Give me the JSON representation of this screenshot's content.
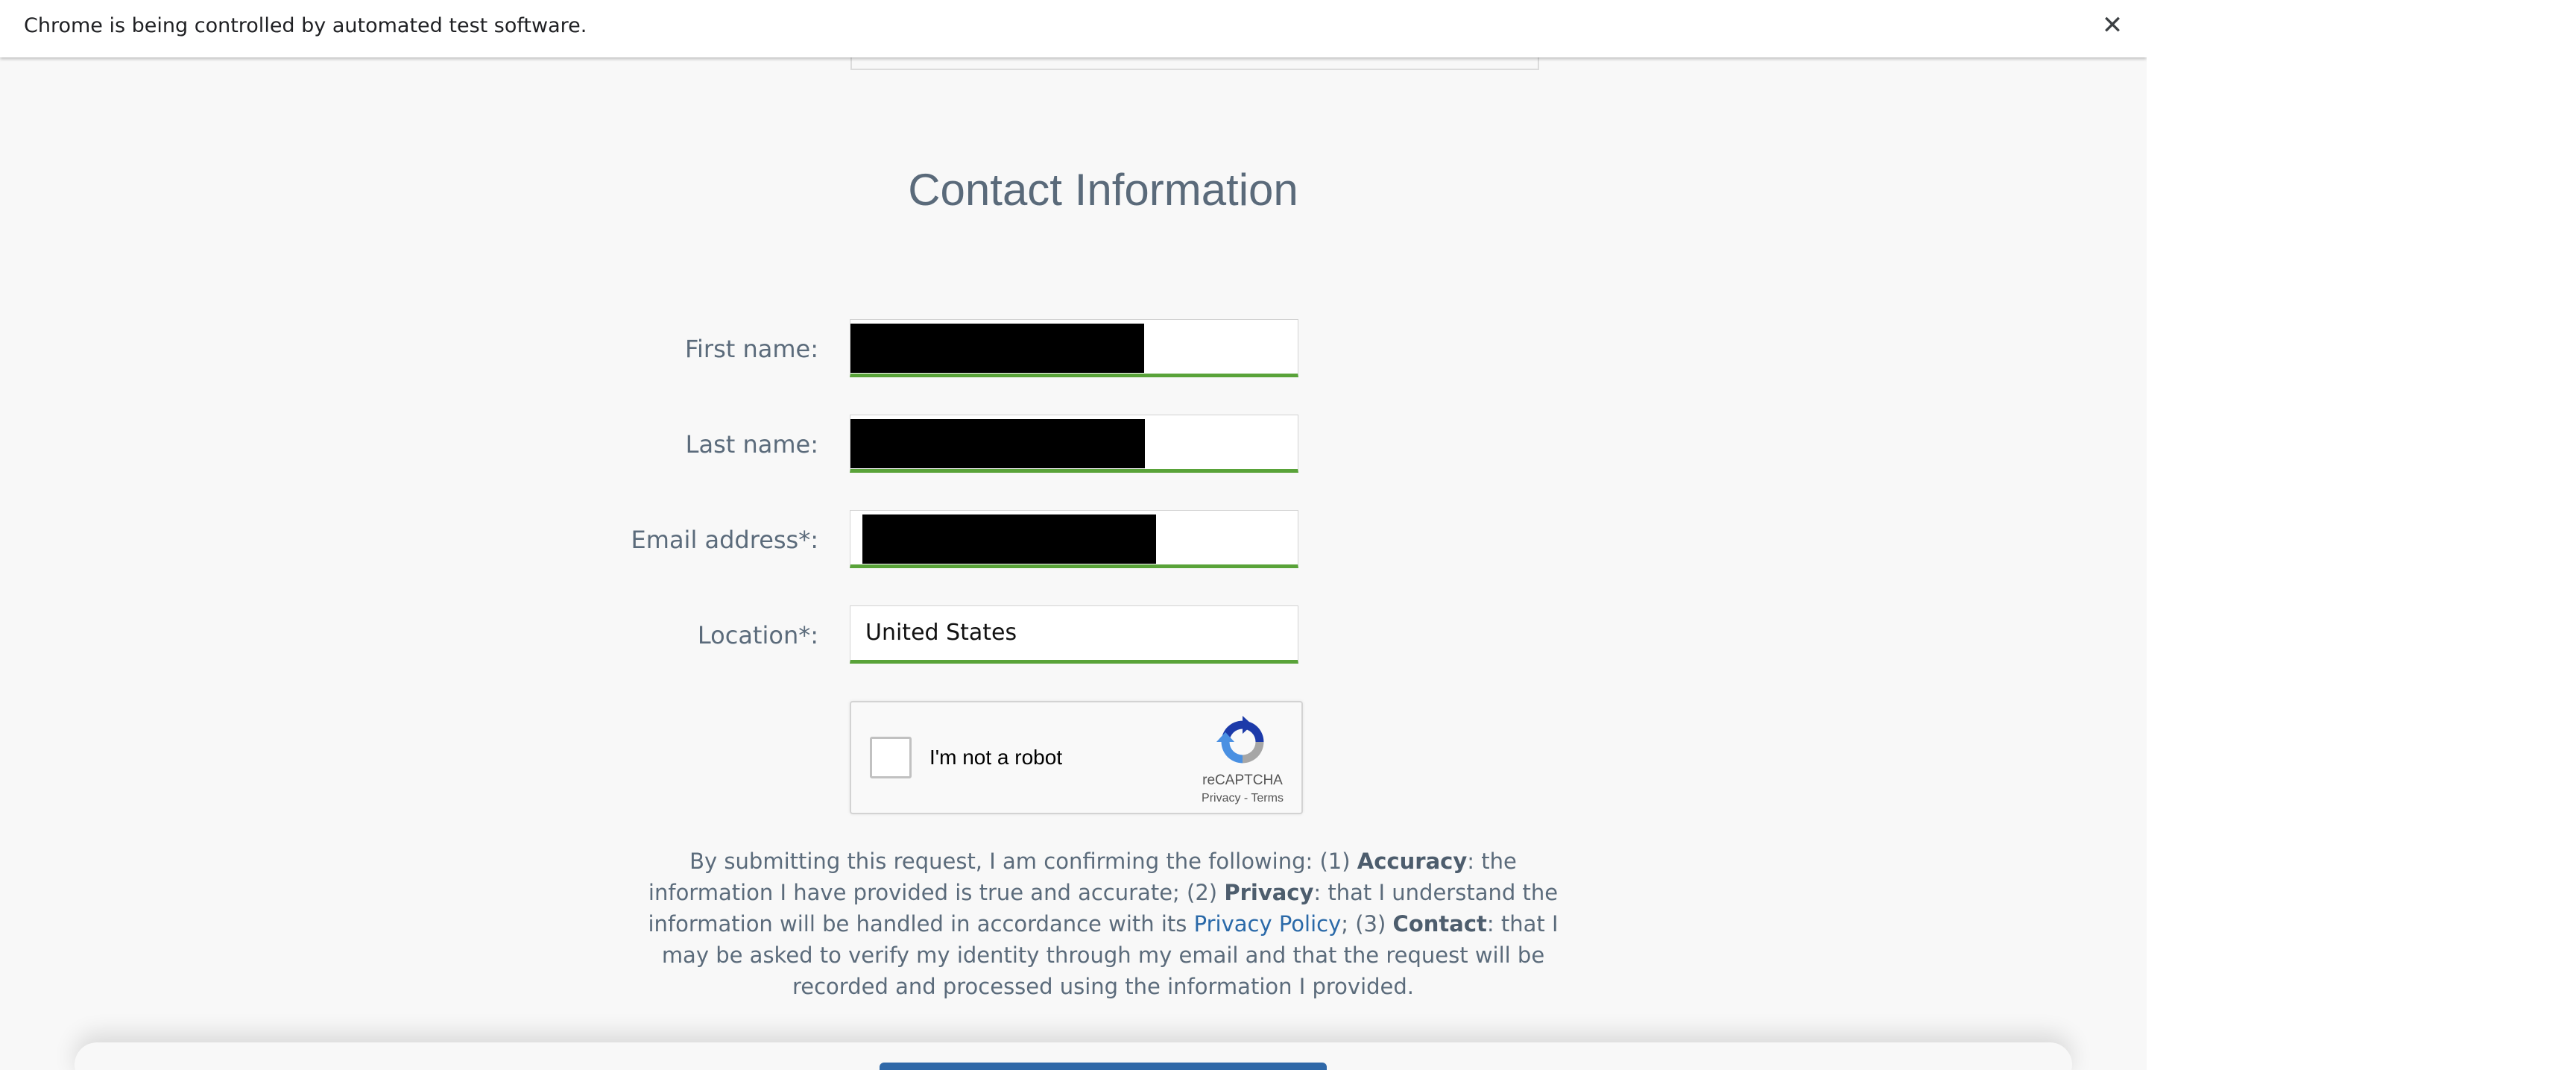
{
  "infobar": {
    "message": "Chrome is being controlled by automated test software.",
    "close_glyph": "✕",
    "close_icon": "close-icon"
  },
  "section": {
    "title": "Contact Information"
  },
  "form": {
    "first_name": {
      "label": "First name:",
      "value": ""
    },
    "last_name": {
      "label": "Last name:",
      "value": ""
    },
    "email": {
      "label": "Email address*:",
      "value": ""
    },
    "location": {
      "label": "Location*:",
      "value": "United States"
    }
  },
  "captcha": {
    "label": "I'm not a robot",
    "brand": "reCAPTCHA",
    "privacy": "Privacy",
    "separator": " - ",
    "terms": "Terms",
    "logo_icon": "recaptcha-logo-icon"
  },
  "disclaimer": {
    "p1": "By submitting this request, I am confirming the following: (1) ",
    "accuracy": "Accuracy",
    "p2": ": the information I have provided is true and accurate; (2) ",
    "privacy": "Privacy",
    "p3": ": that I understand the information will be handled in accordance with its ",
    "privacy_policy": "Privacy Policy",
    "p4": "; (3) ",
    "contact": "Contact",
    "p5": ": that I may be asked to verify my identity through my email and that the request will be recorded and processed using the information I provided."
  },
  "colors": {
    "valid_underline": "#59a339",
    "link": "#2a69a8",
    "label_text": "#5b6b7b",
    "submit_button": "#2f68a8"
  }
}
